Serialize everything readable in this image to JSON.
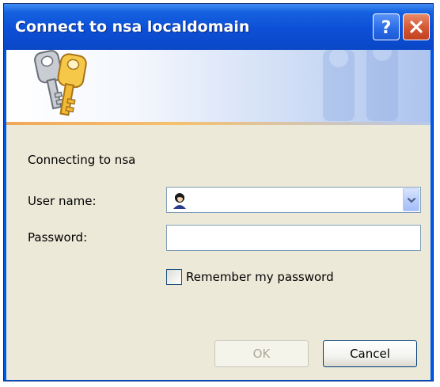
{
  "window": {
    "title": "Connect to nsa localdomain"
  },
  "titlebar": {
    "help_icon": "help-icon",
    "close_icon": "close-icon"
  },
  "banner": {
    "icon": "keys-icon",
    "watermark": "keys-watermark-icon"
  },
  "form": {
    "connecting_text": "Connecting to nsa",
    "username_label": "User name:",
    "username_value": "",
    "username_icon": "user-icon",
    "password_label": "Password:",
    "password_value": "",
    "remember_label": "Remember my password",
    "remember_checked": false
  },
  "buttons": {
    "ok_label": "OK",
    "cancel_label": "Cancel"
  },
  "colors": {
    "titlebar": "#0c4fd6",
    "client_bg": "#ece9d8",
    "close_button": "#d55a36"
  }
}
